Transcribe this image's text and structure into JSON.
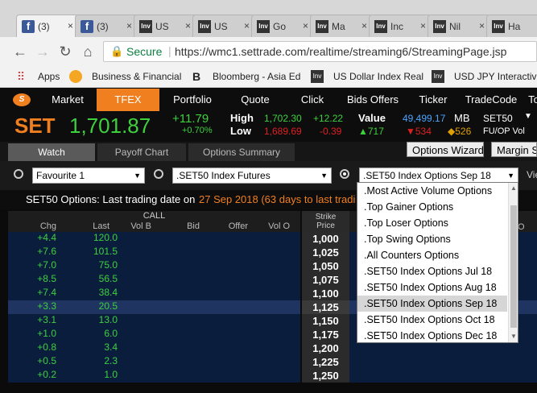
{
  "browser": {
    "tabs": [
      {
        "favicon": "facebook-icon",
        "label": "(3)"
      },
      {
        "favicon": "facebook-icon",
        "label": "(3)"
      },
      {
        "favicon": "investing-icon",
        "label": "US"
      },
      {
        "favicon": "investing-icon",
        "label": "US"
      },
      {
        "favicon": "investing-icon",
        "label": "Go"
      },
      {
        "favicon": "investing-icon",
        "label": "Ma"
      },
      {
        "favicon": "investing-icon",
        "label": "Inc"
      },
      {
        "favicon": "investing-icon",
        "label": "Nil"
      },
      {
        "favicon": "investing-icon",
        "label": "Ha"
      }
    ],
    "close_glyph": "×",
    "secure_label": "Secure",
    "url": "https://wmc1.settrade.com/realtime/streaming6/StreamingPage.jsp",
    "bookmarks": [
      "Apps",
      "Business & Financial",
      "Bloomberg - Asia Ed",
      "US Dollar Index Real",
      "USD JPY Interactive"
    ]
  },
  "app": {
    "menu": [
      "Market",
      "TFEX",
      "Portfolio",
      "Quote",
      "Click",
      "Bids Offers",
      "Ticker",
      "TradeCode",
      "To"
    ],
    "active_menu": "TFEX",
    "index": {
      "name": "SET",
      "value": "1,701.87",
      "change": "+11.79",
      "change_pct": "+0.70%",
      "high_label": "High",
      "high": "1,702.30",
      "high_change": "+12.22",
      "low_label": "Low",
      "low": "1,689.69",
      "low_change": "-0.39",
      "value_label": "Value",
      "value_amount": "49,499.17",
      "value_unit": "MB",
      "up_count": "▲717",
      "down_count": "▼534",
      "unchanged_count": "◆526",
      "ticker": "SET50",
      "sub": "FU/OP Vol"
    },
    "subtabs": [
      "Watch",
      "Payoff Chart",
      "Options Summary"
    ],
    "buttons": {
      "wizard": "Options Wizard",
      "margin": "Margin Si"
    },
    "selectors": {
      "favourite": "Favourite 1",
      "futures": ".SET50 Index Futures",
      "options": ".SET50 Index Options Sep 18",
      "view_label": "Vie"
    },
    "info": {
      "prefix": "SET50 Options: Last trading date on ",
      "highlight": "27 Sep 2018 (63 days to last tradi"
    },
    "dropdown_options": [
      ".Most Active Volume Options",
      ".Top Gainer Options",
      ".Top Loser Options",
      ".Top Swing Options",
      ".All Counters Options",
      ".SET50 Index Options Jul 18",
      ".SET50 Index Options Aug 18",
      ".SET50 Index Options Sep 18",
      ".SET50 Index Options Oct 18",
      ".SET50 Index Options Dec 18"
    ],
    "dropdown_selected_index": 7,
    "table": {
      "call_label": "CALL",
      "columns": [
        "Chg",
        "Last",
        "Vol B",
        "Bid",
        "Offer",
        "Vol O"
      ],
      "strike_label_1": "Strike",
      "strike_label_2": "Price",
      "put_col_hint": "O",
      "rows": [
        {
          "chg": "+4.4",
          "last": "120.0",
          "strike": "1,000"
        },
        {
          "chg": "+7.6",
          "last": "101.5",
          "strike": "1,025"
        },
        {
          "chg": "+7.0",
          "last": "75.0",
          "strike": "1,050"
        },
        {
          "chg": "+8.5",
          "last": "56.5",
          "strike": "1,075"
        },
        {
          "chg": "+7.4",
          "last": "38.4",
          "strike": "1,100"
        },
        {
          "chg": "+3.3",
          "last": "20.5",
          "strike": "1,125"
        },
        {
          "chg": "+3.1",
          "last": "13.0",
          "strike": "1,150"
        },
        {
          "chg": "+1.0",
          "last": "6.0",
          "strike": "1,175"
        },
        {
          "chg": "+0.8",
          "last": "3.4",
          "strike": "1,200"
        },
        {
          "chg": "+0.5",
          "last": "2.3",
          "strike": "1,225"
        },
        {
          "chg": "+0.2",
          "last": "1.0",
          "strike": "1,250"
        }
      ],
      "highlight_row": 5
    }
  },
  "colors": {
    "accent_orange": "#f07f20",
    "up_green": "#3ed13e",
    "down_red": "#e02020",
    "value_blue": "#4aa3ff"
  }
}
